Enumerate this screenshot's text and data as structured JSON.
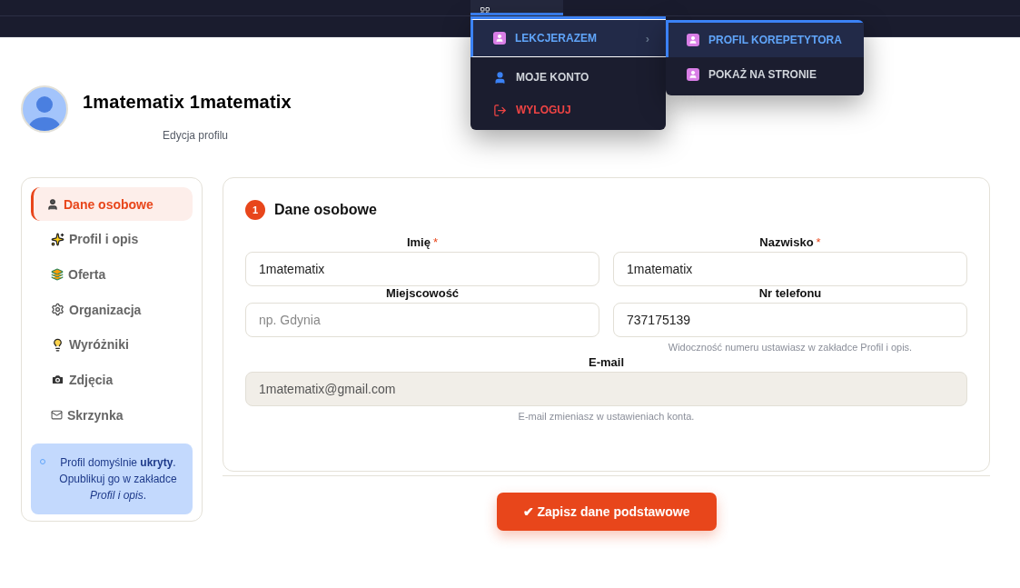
{
  "top_menu": {
    "items": [
      {
        "label": "LEKCJERAZEM",
        "kind": "submenu",
        "selected": true,
        "chevron": "›"
      },
      {
        "label": "MOJE KONTO",
        "kind": "account",
        "selected": false
      },
      {
        "label": "WYLOGUJ",
        "kind": "logout",
        "selected": false
      }
    ],
    "submenu": [
      {
        "label": "PROFIL KOREPETYTORA",
        "selected": true
      },
      {
        "label": "POKAŻ NA STRONIE",
        "selected": false
      }
    ]
  },
  "profile": {
    "name": "1matematix 1matematix",
    "subtitle": "Edycja profilu"
  },
  "sidebar": {
    "items": [
      {
        "label": "Dane osobowe",
        "selected": true
      },
      {
        "label": "Profil i opis",
        "selected": false
      },
      {
        "label": "Oferta",
        "selected": false
      },
      {
        "label": "Organizacja",
        "selected": false
      },
      {
        "label": "Wyróżniki",
        "selected": false
      },
      {
        "label": "Zdjęcia",
        "selected": false
      },
      {
        "label": "Skrzynka",
        "selected": false
      }
    ],
    "notice": "Profil domyślnie **ukryty**. Opublikuj go w zakładce *Profil i opis*."
  },
  "section": {
    "number": "1",
    "title": "Dane osobowe",
    "rows": [
      [
        {
          "label": "Imię",
          "required_mark": "*",
          "value": "1matematix"
        },
        {
          "label": "Nazwisko",
          "required_mark": "*",
          "value": "1matematix"
        }
      ],
      [
        {
          "label": "Miejscowość",
          "placeholder": "np. Gdynia"
        },
        {
          "label": "Nr telefonu",
          "value": "737175139",
          "hint": "Widoczność numeru ustawiasz w zakładce Profil i opis."
        }
      ],
      [
        {
          "label": "E-mail",
          "value": "1matematix@gmail.com",
          "disabled": true,
          "hint": "E-mail zmieniasz w ustawieniach konta."
        }
      ]
    ]
  },
  "submit": {
    "label": "✔ Zapisz dane podstawowe"
  }
}
